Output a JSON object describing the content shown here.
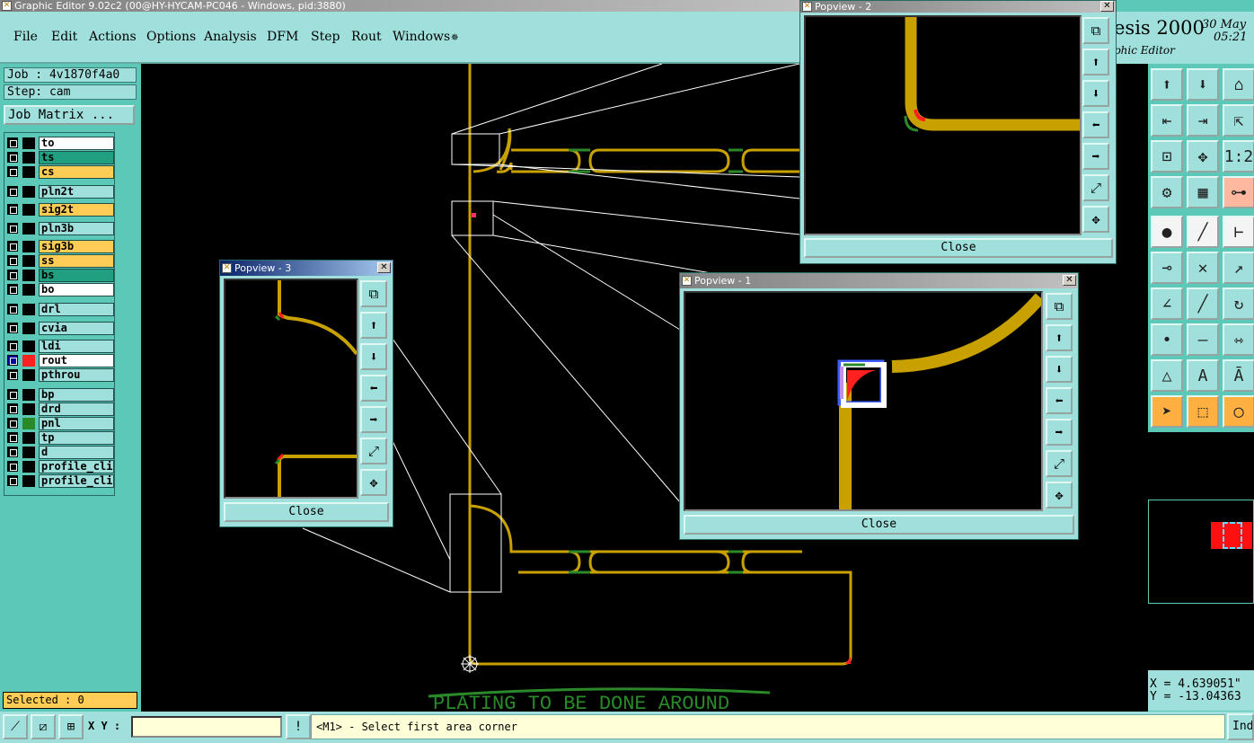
{
  "main_window": {
    "title": "Graphic Editor 9.02c2 (00@HY-HYCAM-PC046 - Windows, pid:3880)"
  },
  "menu": [
    "File",
    "Edit",
    "Actions",
    "Options",
    "Analysis",
    "DFM",
    "Step",
    "Rout",
    "Windows"
  ],
  "logo": {
    "brand": "esis 2000",
    "subtitle": "phic Editor",
    "date": "30 May",
    "time": "05:21"
  },
  "job": {
    "job_label": "Job : 4v1870f4a0",
    "step_label": "Step: cam",
    "matrix_button": "Job Matrix ..."
  },
  "layers": [
    {
      "name": "to",
      "color": "#ffffff"
    },
    {
      "name": "ts",
      "color": "#20a080"
    },
    {
      "name": "cs",
      "color": "#ffcc55"
    },
    {
      "name": "pln2t",
      "color": "#a0e0dc"
    },
    {
      "name": "sig2t",
      "color": "#ffcc55"
    },
    {
      "name": "pln3b",
      "color": "#a0e0dc"
    },
    {
      "name": "sig3b",
      "color": "#ffcc55"
    },
    {
      "name": "ss",
      "color": "#ffcc55"
    },
    {
      "name": "bs",
      "color": "#20a080"
    },
    {
      "name": "bo",
      "color": "#ffffff"
    },
    {
      "name": "drl",
      "color": "#a0e0dc"
    },
    {
      "name": "cvia",
      "color": "#a0e0dc"
    },
    {
      "name": "ldi",
      "color": "#a0e0dc"
    },
    {
      "name": "rout",
      "color": "#ffffff"
    },
    {
      "name": "pthrou",
      "color": "#a0e0dc"
    },
    {
      "name": "bp",
      "color": "#a0e0dc"
    },
    {
      "name": "drd",
      "color": "#a0e0dc"
    },
    {
      "name": "pnl",
      "color": "#a0e0dc"
    },
    {
      "name": "tp",
      "color": "#a0e0dc"
    },
    {
      "name": "d",
      "color": "#a0e0dc"
    },
    {
      "name": "profile_cli",
      "color": "#a0e0dc"
    },
    {
      "name": "profile_cli",
      "color": "#a0e0dc"
    }
  ],
  "selected": "Selected : 0",
  "canvas_text": "PLATING TO BE DONE AROUND",
  "popviews": {
    "pv1": {
      "title": "Popview - 1",
      "close": "Close"
    },
    "pv2": {
      "title": "Popview - 2",
      "close": "Close"
    },
    "pv3": {
      "title": "Popview - 3",
      "close": "Close"
    }
  },
  "coords": {
    "x": "X = 4.639051\"",
    "y": "Y = -13.04363"
  },
  "bottom": {
    "xy_label": "X Y :",
    "xy_value": "",
    "prompt": "<M1> - Select first area corner",
    "ind_label": "Ind"
  },
  "colors": {
    "panel": "#5cc8b8",
    "button": "#a0e0dc",
    "trace": "#c8a000",
    "pad": "#2a8a2a"
  }
}
